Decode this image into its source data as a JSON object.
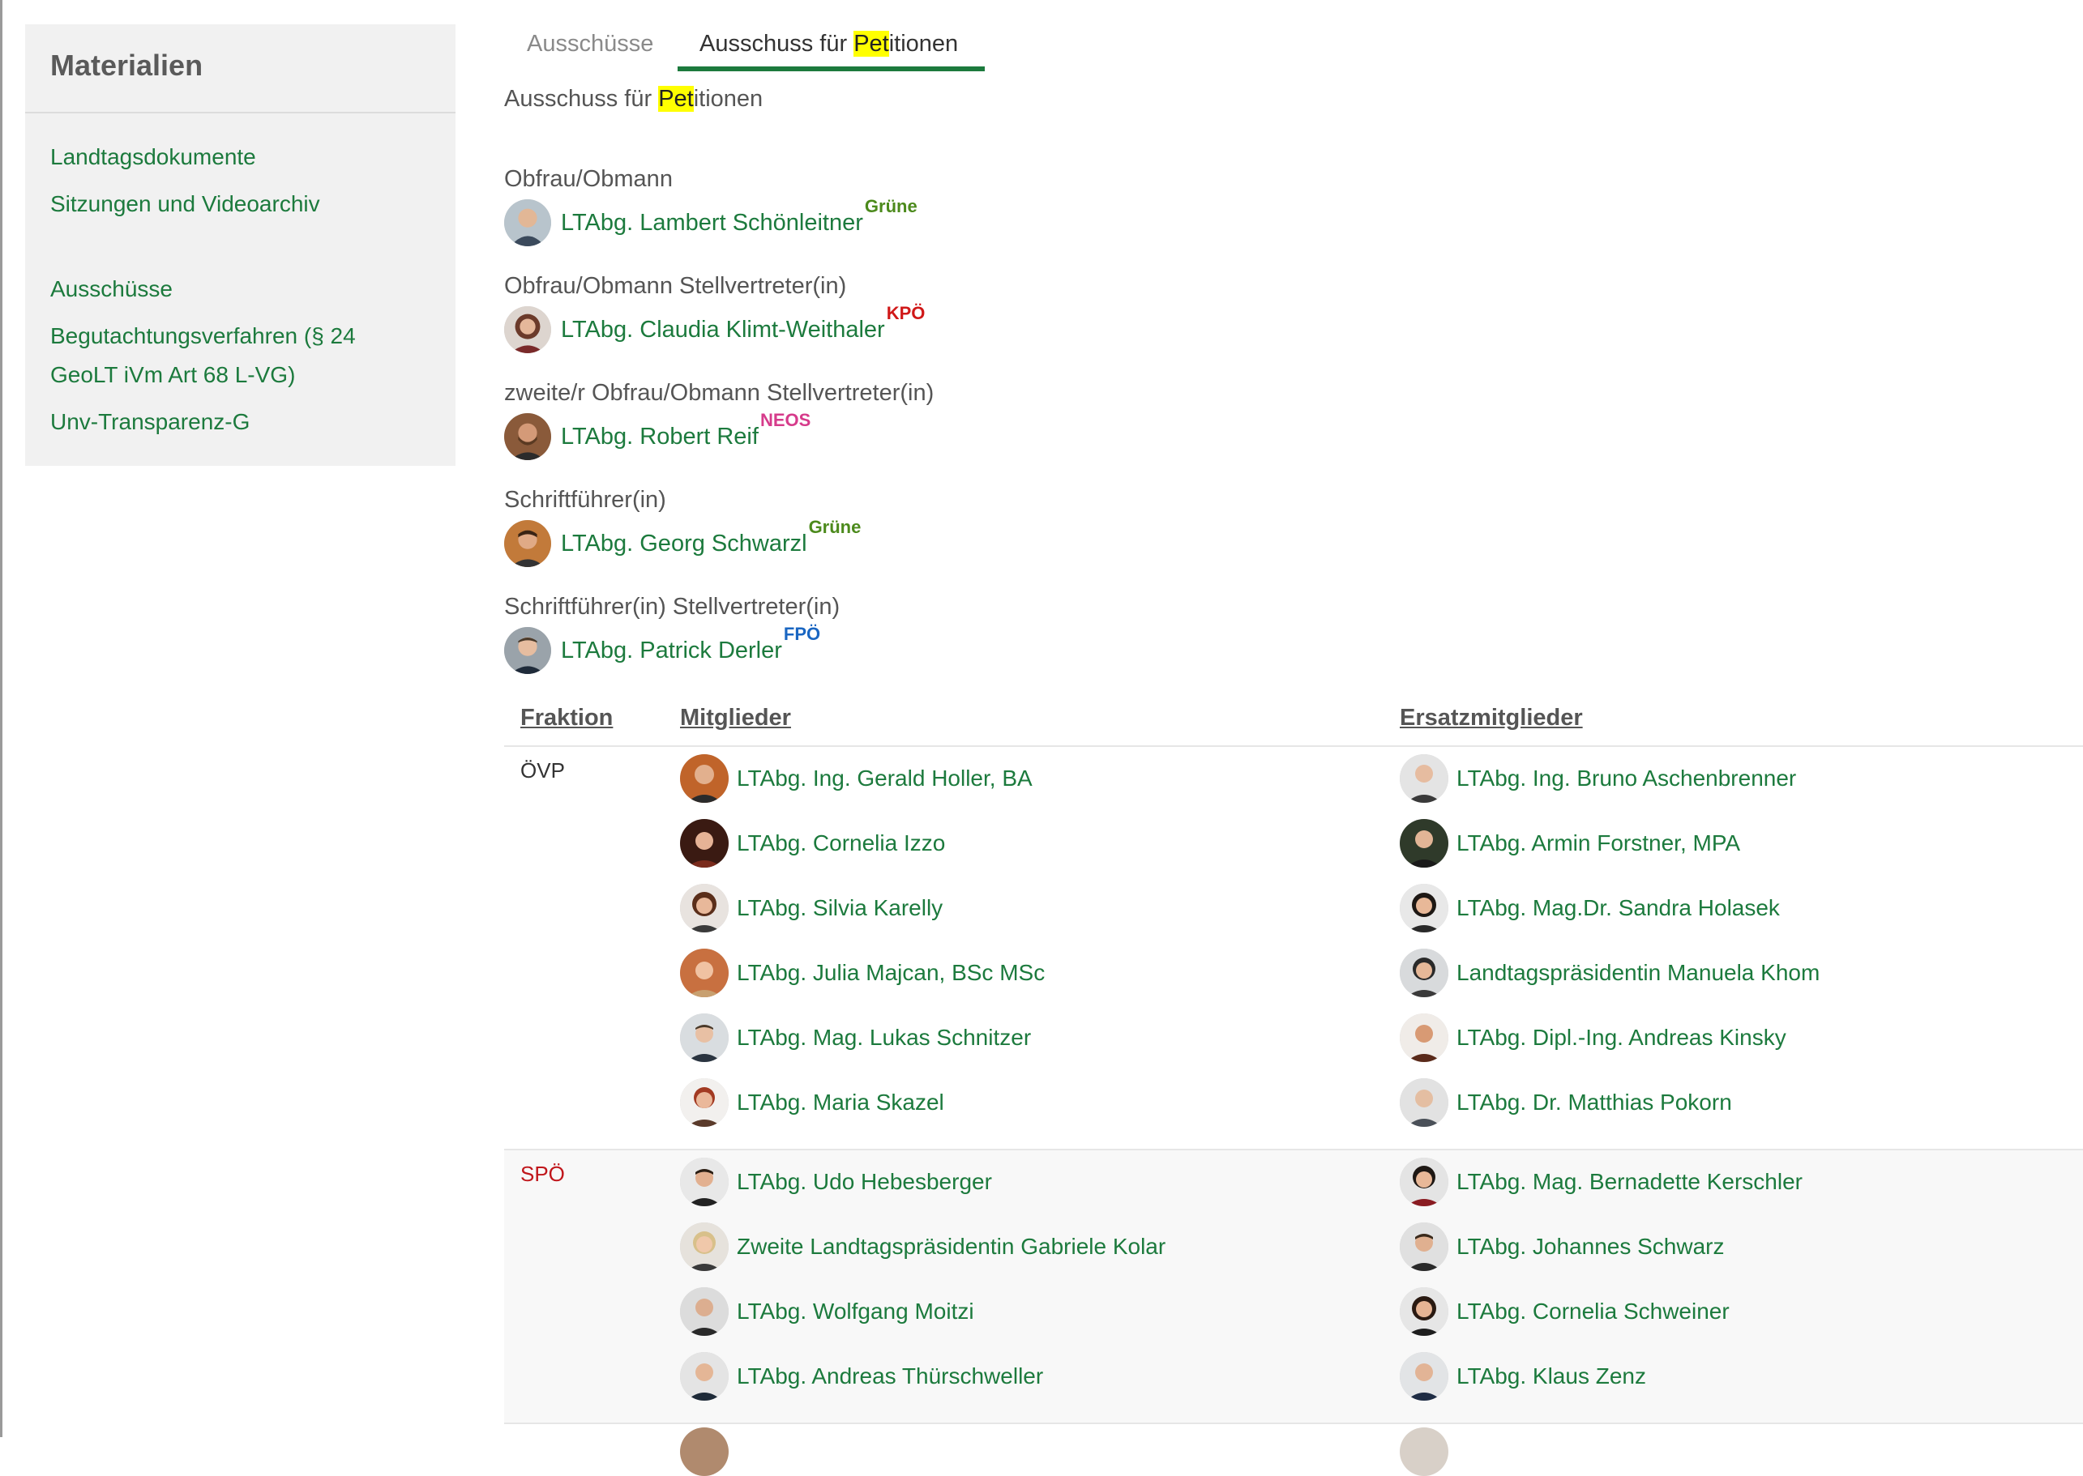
{
  "sidebar": {
    "title": "Materialien",
    "links": [
      "Landtagsdokumente",
      "Sitzungen und Videoarchiv",
      "Ausschüsse",
      "Begutachtungsverfahren (§ 24",
      "GeoLT iVm Art 68 L-VG)",
      "Unv-Transparenz-G"
    ]
  },
  "tabs": {
    "inactive": "Ausschüsse",
    "active_prefix": "Ausschuss für ",
    "active_highlight": "Pet",
    "active_suffix": "itionen"
  },
  "title": {
    "prefix": "Ausschuss für ",
    "highlight": "Pet",
    "suffix": "itionen"
  },
  "officials": [
    {
      "role": "Obfrau/Obmann",
      "name": "LTAbg. Lambert Schönleitner",
      "party": "Grüne",
      "party_color": "#4c8a1c"
    },
    {
      "role": "Obfrau/Obmann Stellvertreter(in)",
      "name": "LTAbg. Claudia Klimt-Weithaler",
      "party": "KPÖ",
      "party_color": "#d01818"
    },
    {
      "role": "zweite/r Obfrau/Obmann Stellvertreter(in)",
      "name": "LTAbg. Robert Reif",
      "party": "NEOS",
      "party_color": "#d63b8b"
    },
    {
      "role": "Schriftführer(in)",
      "name": "LTAbg. Georg Schwarzl",
      "party": "Grüne",
      "party_color": "#4c8a1c"
    },
    {
      "role": "Schriftführer(in) Stellvertreter(in)",
      "name": "LTAbg. Patrick Derler",
      "party": "FPÖ",
      "party_color": "#1a66c2"
    }
  ],
  "table": {
    "headers": {
      "fraktion": "Fraktion",
      "mitglieder": "Mitglieder",
      "ersatz": "Ersatzmitglieder"
    },
    "groups": [
      {
        "fraktion": "ÖVP",
        "mitglieder": [
          "LTAbg. Ing. Gerald Holler, BA",
          "LTAbg. Cornelia Izzo",
          "LTAbg. Silvia Karelly",
          "LTAbg. Julia Majcan, BSc MSc",
          "LTAbg. Mag. Lukas Schnitzer",
          "LTAbg. Maria Skazel"
        ],
        "ersatz": [
          "LTAbg. Ing. Bruno Aschenbrenner",
          "LTAbg. Armin Forstner, MPA",
          "LTAbg. Mag.Dr. Sandra Holasek",
          "Landtagspräsidentin Manuela Khom",
          "LTAbg. Dipl.-Ing. Andreas Kinsky",
          "LTAbg. Dr. Matthias Pokorn"
        ]
      },
      {
        "fraktion": "SPÖ",
        "mitglieder": [
          "LTAbg. Udo Hebesberger",
          "Zweite Landtagspräsidentin Gabriele Kolar",
          "LTAbg. Wolfgang Moitzi",
          "LTAbg. Andreas Thürschweller"
        ],
        "ersatz": [
          "LTAbg. Mag. Bernadette Kerschler",
          "LTAbg. Johannes Schwarz",
          "LTAbg. Cornelia Schweiner",
          "LTAbg. Klaus Zenz"
        ]
      }
    ]
  },
  "colors": {
    "link": "#1c7a3d",
    "highlight": "#ffff00",
    "sidebar_bg": "#f1f1f1",
    "spoe": "#c0161b"
  }
}
